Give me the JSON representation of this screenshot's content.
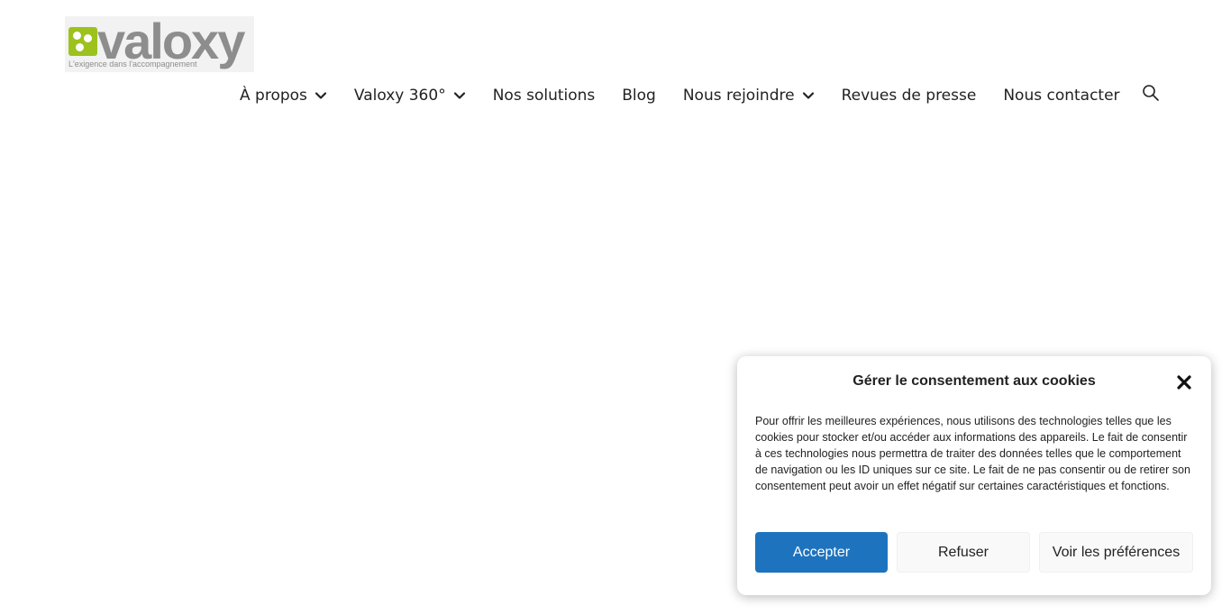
{
  "logo": {
    "word": "valoxy",
    "tagline": "L'exigence dans l'accompagnement",
    "accent_color": "#9dc21e"
  },
  "nav": {
    "items": [
      {
        "label": "À propos",
        "has_dropdown": true
      },
      {
        "label": "Valoxy 360°",
        "has_dropdown": true
      },
      {
        "label": "Nos solutions",
        "has_dropdown": false
      },
      {
        "label": "Blog",
        "has_dropdown": false
      },
      {
        "label": "Nous rejoindre",
        "has_dropdown": true
      },
      {
        "label": "Revues de presse",
        "has_dropdown": false
      },
      {
        "label": "Nous contacter",
        "has_dropdown": false
      }
    ],
    "search_icon": "search-icon"
  },
  "cookie": {
    "title": "Gérer le consentement aux cookies",
    "body": "Pour offrir les meilleures expériences, nous utilisons des technologies telles que les cookies pour stocker et/ou accéder aux informations des appareils. Le fait de consentir à ces technologies nous permettra de traiter des données telles que le comportement de navigation ou les ID uniques sur ce site. Le fait de ne pas consentir ou de retirer son consentement peut avoir un effet négatif sur certaines caractéristiques et fonctions.",
    "accept_label": "Accepter",
    "refuse_label": "Refuser",
    "prefs_label": "Voir les préférences",
    "accept_color": "#1e73be"
  }
}
